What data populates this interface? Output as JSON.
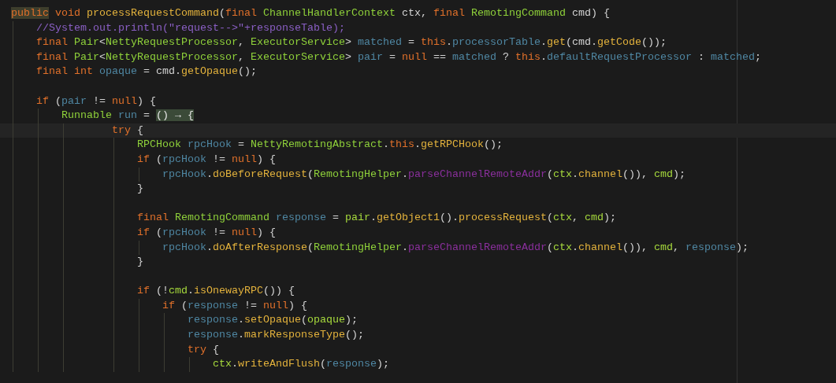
{
  "editor": {
    "lines": [
      {
        "current": false,
        "tokens": [
          {
            "kind": "keyword-marked",
            "text": "public"
          },
          {
            "kind": "keyword",
            "text": " void"
          },
          {
            "kind": "method",
            "text": " processRequestCommand"
          },
          {
            "kind": "plain",
            "text": "("
          },
          {
            "kind": "keyword",
            "text": "final"
          },
          {
            "kind": "type",
            "text": " ChannelHandlerContext"
          },
          {
            "kind": "plain",
            "text": " ctx, "
          },
          {
            "kind": "keyword",
            "text": "final"
          },
          {
            "kind": "type",
            "text": " RemotingCommand"
          },
          {
            "kind": "plain",
            "text": " cmd) {"
          }
        ]
      },
      {
        "current": false,
        "tokens": [
          {
            "kind": "comment",
            "text": "    //System.out.println(\"request-->\"+responseTable);"
          }
        ]
      },
      {
        "current": false,
        "tokens": [
          {
            "kind": "keyword",
            "text": "    final"
          },
          {
            "kind": "type",
            "text": " Pair"
          },
          {
            "kind": "plain",
            "text": "<"
          },
          {
            "kind": "type",
            "text": "NettyRequestProcessor"
          },
          {
            "kind": "plain",
            "text": ", "
          },
          {
            "kind": "type",
            "text": "ExecutorService"
          },
          {
            "kind": "plain",
            "text": "> "
          },
          {
            "kind": "field",
            "text": "matched"
          },
          {
            "kind": "plain",
            "text": " = "
          },
          {
            "kind": "keyword",
            "text": "this"
          },
          {
            "kind": "plain",
            "text": "."
          },
          {
            "kind": "field",
            "text": "processorTable"
          },
          {
            "kind": "plain",
            "text": "."
          },
          {
            "kind": "method",
            "text": "get"
          },
          {
            "kind": "plain",
            "text": "(cmd."
          },
          {
            "kind": "method",
            "text": "getCode"
          },
          {
            "kind": "plain",
            "text": "());"
          }
        ]
      },
      {
        "current": false,
        "tokens": [
          {
            "kind": "keyword",
            "text": "    final"
          },
          {
            "kind": "type",
            "text": " Pair"
          },
          {
            "kind": "plain",
            "text": "<"
          },
          {
            "kind": "type",
            "text": "NettyRequestProcessor"
          },
          {
            "kind": "plain",
            "text": ", "
          },
          {
            "kind": "type",
            "text": "ExecutorService"
          },
          {
            "kind": "plain",
            "text": "> "
          },
          {
            "kind": "field",
            "text": "pair"
          },
          {
            "kind": "plain",
            "text": " = "
          },
          {
            "kind": "keyword",
            "text": "null"
          },
          {
            "kind": "plain",
            "text": " == "
          },
          {
            "kind": "field",
            "text": "matched"
          },
          {
            "kind": "plain",
            "text": " ? "
          },
          {
            "kind": "keyword",
            "text": "this"
          },
          {
            "kind": "plain",
            "text": "."
          },
          {
            "kind": "field",
            "text": "defaultRequestProcessor"
          },
          {
            "kind": "plain",
            "text": " : "
          },
          {
            "kind": "field",
            "text": "matched"
          },
          {
            "kind": "plain",
            "text": ";"
          }
        ]
      },
      {
        "current": false,
        "tokens": [
          {
            "kind": "keyword",
            "text": "    final"
          },
          {
            "kind": "keyword",
            "text": " int"
          },
          {
            "kind": "field",
            "text": " opaque"
          },
          {
            "kind": "plain",
            "text": " = cmd."
          },
          {
            "kind": "method",
            "text": "getOpaque"
          },
          {
            "kind": "plain",
            "text": "();"
          }
        ]
      },
      {
        "current": false
      },
      {
        "current": false,
        "tokens": [
          {
            "kind": "keyword",
            "text": "    if"
          },
          {
            "kind": "plain",
            "text": " ("
          },
          {
            "kind": "field",
            "text": "pair"
          },
          {
            "kind": "plain",
            "text": " != "
          },
          {
            "kind": "keyword",
            "text": "null"
          },
          {
            "kind": "plain",
            "text": ") {"
          }
        ]
      },
      {
        "current": false,
        "tokens": [
          {
            "kind": "type",
            "text": "        Runnable"
          },
          {
            "kind": "field",
            "text": " run"
          },
          {
            "kind": "plain",
            "text": " = "
          },
          {
            "kind": "plain-marked",
            "text": "() → {"
          }
        ]
      },
      {
        "current": true,
        "tokens": [
          {
            "kind": "keyword",
            "text": "                try"
          },
          {
            "kind": "plain",
            "text": " {"
          }
        ]
      },
      {
        "current": false,
        "tokens": [
          {
            "kind": "type",
            "text": "                    RPCHook"
          },
          {
            "kind": "field",
            "text": " rpcHook"
          },
          {
            "kind": "plain",
            "text": " = "
          },
          {
            "kind": "type",
            "text": "NettyRemotingAbstract"
          },
          {
            "kind": "plain",
            "text": "."
          },
          {
            "kind": "keyword",
            "text": "this"
          },
          {
            "kind": "plain",
            "text": "."
          },
          {
            "kind": "method",
            "text": "getRPCHook"
          },
          {
            "kind": "plain",
            "text": "();"
          }
        ]
      },
      {
        "current": false,
        "tokens": [
          {
            "kind": "keyword",
            "text": "                    if"
          },
          {
            "kind": "plain",
            "text": " ("
          },
          {
            "kind": "field",
            "text": "rpcHook"
          },
          {
            "kind": "plain",
            "text": " != "
          },
          {
            "kind": "keyword",
            "text": "null"
          },
          {
            "kind": "plain",
            "text": ") {"
          }
        ]
      },
      {
        "current": false,
        "tokens": [
          {
            "kind": "field",
            "text": "                        rpcHook"
          },
          {
            "kind": "plain",
            "text": "."
          },
          {
            "kind": "method",
            "text": "doBeforeRequest"
          },
          {
            "kind": "plain",
            "text": "("
          },
          {
            "kind": "type",
            "text": "RemotingHelper"
          },
          {
            "kind": "plain",
            "text": "."
          },
          {
            "kind": "static",
            "text": "parseChannelRemoteAddr"
          },
          {
            "kind": "plain",
            "text": "("
          },
          {
            "kind": "param",
            "text": "ctx"
          },
          {
            "kind": "plain",
            "text": "."
          },
          {
            "kind": "method",
            "text": "channel"
          },
          {
            "kind": "plain",
            "text": "()), "
          },
          {
            "kind": "param",
            "text": "cmd"
          },
          {
            "kind": "plain",
            "text": ");"
          }
        ]
      },
      {
        "current": false,
        "tokens": [
          {
            "kind": "plain",
            "text": "                    }"
          }
        ]
      },
      {
        "current": false
      },
      {
        "current": false,
        "tokens": [
          {
            "kind": "keyword",
            "text": "                    final"
          },
          {
            "kind": "type",
            "text": " RemotingCommand"
          },
          {
            "kind": "field",
            "text": " response"
          },
          {
            "kind": "plain",
            "text": " = "
          },
          {
            "kind": "param",
            "text": "pair"
          },
          {
            "kind": "plain",
            "text": "."
          },
          {
            "kind": "method",
            "text": "getObject1"
          },
          {
            "kind": "plain",
            "text": "()."
          },
          {
            "kind": "method",
            "text": "processRequest"
          },
          {
            "kind": "plain",
            "text": "("
          },
          {
            "kind": "param",
            "text": "ctx"
          },
          {
            "kind": "plain",
            "text": ", "
          },
          {
            "kind": "param",
            "text": "cmd"
          },
          {
            "kind": "plain",
            "text": ");"
          }
        ]
      },
      {
        "current": false,
        "tokens": [
          {
            "kind": "keyword",
            "text": "                    if"
          },
          {
            "kind": "plain",
            "text": " ("
          },
          {
            "kind": "field",
            "text": "rpcHook"
          },
          {
            "kind": "plain",
            "text": " != "
          },
          {
            "kind": "keyword",
            "text": "null"
          },
          {
            "kind": "plain",
            "text": ") {"
          }
        ]
      },
      {
        "current": false,
        "tokens": [
          {
            "kind": "field",
            "text": "                        rpcHook"
          },
          {
            "kind": "plain",
            "text": "."
          },
          {
            "kind": "method",
            "text": "doAfterResponse"
          },
          {
            "kind": "plain",
            "text": "("
          },
          {
            "kind": "type",
            "text": "RemotingHelper"
          },
          {
            "kind": "plain",
            "text": "."
          },
          {
            "kind": "static",
            "text": "parseChannelRemoteAddr"
          },
          {
            "kind": "plain",
            "text": "("
          },
          {
            "kind": "param",
            "text": "ctx"
          },
          {
            "kind": "plain",
            "text": "."
          },
          {
            "kind": "method",
            "text": "channel"
          },
          {
            "kind": "plain",
            "text": "()), "
          },
          {
            "kind": "param",
            "text": "cmd"
          },
          {
            "kind": "plain",
            "text": ", "
          },
          {
            "kind": "field",
            "text": "response"
          },
          {
            "kind": "plain",
            "text": ");"
          }
        ]
      },
      {
        "current": false,
        "tokens": [
          {
            "kind": "plain",
            "text": "                    }"
          }
        ]
      },
      {
        "current": false
      },
      {
        "current": false,
        "tokens": [
          {
            "kind": "keyword",
            "text": "                    if"
          },
          {
            "kind": "plain",
            "text": " (!"
          },
          {
            "kind": "param",
            "text": "cmd"
          },
          {
            "kind": "plain",
            "text": "."
          },
          {
            "kind": "method",
            "text": "isOnewayRPC"
          },
          {
            "kind": "plain",
            "text": "()) {"
          }
        ]
      },
      {
        "current": false,
        "tokens": [
          {
            "kind": "keyword",
            "text": "                        if"
          },
          {
            "kind": "plain",
            "text": " ("
          },
          {
            "kind": "field",
            "text": "response"
          },
          {
            "kind": "plain",
            "text": " != "
          },
          {
            "kind": "keyword",
            "text": "null"
          },
          {
            "kind": "plain",
            "text": ") {"
          }
        ]
      },
      {
        "current": false,
        "tokens": [
          {
            "kind": "field",
            "text": "                            response"
          },
          {
            "kind": "plain",
            "text": "."
          },
          {
            "kind": "method",
            "text": "setOpaque"
          },
          {
            "kind": "plain",
            "text": "("
          },
          {
            "kind": "param",
            "text": "opaque"
          },
          {
            "kind": "plain",
            "text": ");"
          }
        ]
      },
      {
        "current": false,
        "tokens": [
          {
            "kind": "field",
            "text": "                            response"
          },
          {
            "kind": "plain",
            "text": "."
          },
          {
            "kind": "method",
            "text": "markResponseType"
          },
          {
            "kind": "plain",
            "text": "();"
          }
        ]
      },
      {
        "current": false,
        "tokens": [
          {
            "kind": "keyword",
            "text": "                            try"
          },
          {
            "kind": "plain",
            "text": " {"
          }
        ]
      },
      {
        "current": false,
        "tokens": [
          {
            "kind": "param",
            "text": "                                ctx"
          },
          {
            "kind": "plain",
            "text": "."
          },
          {
            "kind": "method",
            "text": "writeAndFlush"
          },
          {
            "kind": "plain",
            "text": "("
          },
          {
            "kind": "field",
            "text": "response"
          },
          {
            "kind": "plain",
            "text": ");"
          }
        ]
      }
    ]
  }
}
